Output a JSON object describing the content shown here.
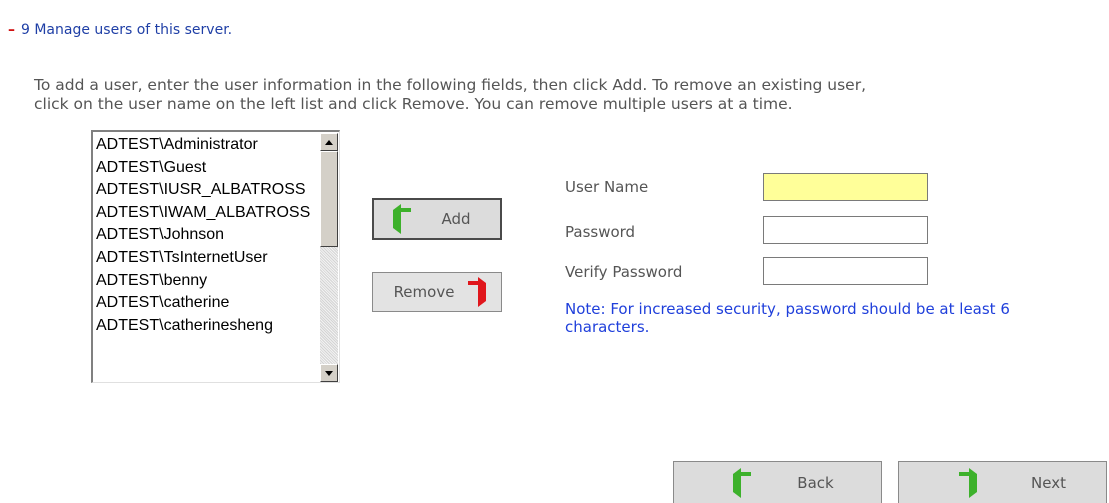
{
  "header": {
    "toggle": "–",
    "title": "9 Manage users of this server."
  },
  "instructions": {
    "line1": "To add a user, enter the user information in the following fields, then click Add. To remove an existing user,",
    "line2": "click on the user name on the left list and click Remove. You can remove multiple users at a time."
  },
  "user_list": {
    "items": [
      "ADTEST\\Administrator",
      "ADTEST\\Guest",
      "ADTEST\\IUSR_ALBATROSS",
      "ADTEST\\IWAM_ALBATROSS",
      "ADTEST\\Johnson",
      "ADTEST\\TsInternetUser",
      "ADTEST\\benny",
      "ADTEST\\catherine",
      "ADTEST\\catherinesheng"
    ]
  },
  "buttons": {
    "add": "Add",
    "remove": "Remove",
    "back": "Back",
    "next": "Next"
  },
  "form": {
    "user_name_label": "User Name",
    "user_name_value": "",
    "password_label": "Password",
    "password_value": "",
    "verify_password_label": "Verify Password",
    "verify_password_value": "",
    "note": "Note: For increased security, password should be at least 6 characters."
  },
  "colors": {
    "header_blue": "#1f3fa6",
    "note_blue": "#1f3fdb",
    "focus_yellow": "#ffff99",
    "arrow_green": "#3db12b",
    "arrow_red": "#e0161c"
  }
}
